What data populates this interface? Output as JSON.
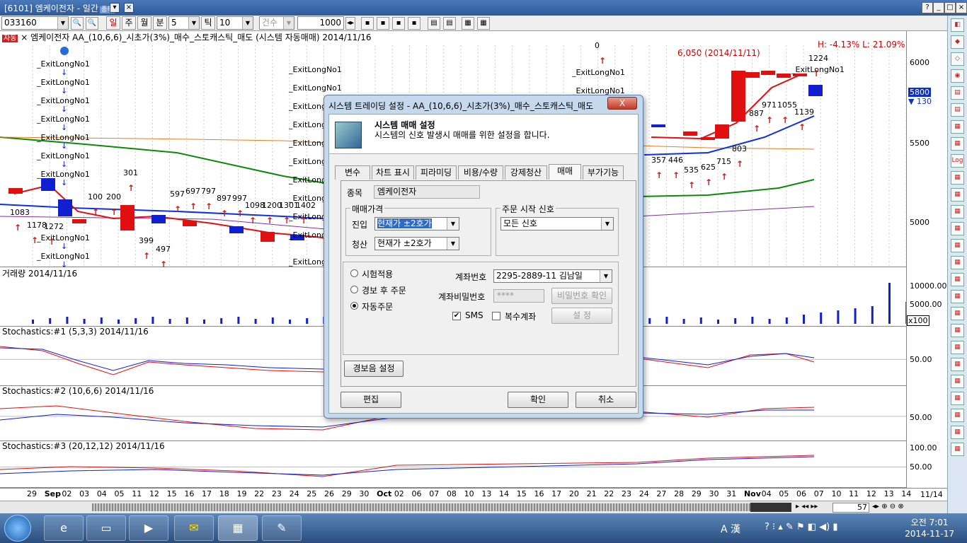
{
  "window": {
    "title": "[6101] 엠케이전자 - 일간",
    "title_badge": "종목",
    "controls": [
      "_",
      "□",
      "×"
    ]
  },
  "toolbar": {
    "code": "033160",
    "period_buttons": [
      "일",
      "주",
      "월",
      "분"
    ],
    "minute_value": "5",
    "tick_label": "틱",
    "tick_value": "10",
    "count_label": "건수",
    "count_value": "1000"
  },
  "price_panel": {
    "header": "엠케이전자 AA_(10,6,6)_시초가(3%)_매수_스토캐스틱_매도 (시스템 자동매매) 2014/11/16",
    "tag": "자동",
    "high_low": "H: -4.13%  L: 21.09%",
    "annotation_high": "6,050 (2014/11/11)",
    "axis_labels": [
      "6000",
      "5500",
      "5000"
    ],
    "current_price": "5800",
    "current_change": "▼ 130",
    "exit_label": "_ExitLongNo1",
    "signal_labels": [
      "1083",
      "1178",
      "1272",
      "100",
      "200",
      "301",
      "399",
      "497",
      "597",
      "697",
      "797",
      "897",
      "997",
      "1098",
      "1200",
      "1301",
      "1402",
      "357",
      "446",
      "535",
      "625",
      "715",
      "803",
      "887",
      "971",
      "1055",
      "1139",
      "1224",
      "0"
    ]
  },
  "volume_panel": {
    "title": "거래량 2014/11/16",
    "axis_labels": [
      "10000.00",
      "5000.00"
    ],
    "unit": "x100"
  },
  "stoch1_panel": {
    "title": "Stochastics:#1 (5,3,3) 2014/11/16",
    "axis_labels": [
      "50.00"
    ]
  },
  "stoch2_panel": {
    "title": "Stochastics:#2 (10,6,6) 2014/11/16",
    "axis_labels": [
      "50.00"
    ]
  },
  "stoch3_panel": {
    "title": "Stochastics:#3 (20,12,12) 2014/11/16",
    "axis_labels": [
      "100.00",
      "50.00"
    ]
  },
  "date_axis": [
    "29",
    "Sep",
    "02",
    "03",
    "04",
    "05",
    "11",
    "12",
    "15",
    "16",
    "17",
    "18",
    "19",
    "22",
    "23",
    "24",
    "25",
    "26",
    "29",
    "30",
    "Oct",
    "02",
    "06",
    "07",
    "08",
    "10",
    "13",
    "14",
    "15",
    "16",
    "17",
    "20",
    "21",
    "22",
    "23",
    "24",
    "27",
    "28",
    "29",
    "30",
    "31",
    "Nov",
    "04",
    "05",
    "06",
    "07",
    "10",
    "11",
    "12",
    "13",
    "14"
  ],
  "date_axis_end": "11/14",
  "scroll": {
    "count": "57"
  },
  "dialog": {
    "title": "시스템 트레이딩 설정 - AA_(10,6,6)_시초가(3%)_매수_스토캐스틱_매도",
    "close_label": "X",
    "header_title": "시스템 매매 설정",
    "header_desc": "시스템의 신호 발생시 매매를 위한 설정을 합니다.",
    "tabs": [
      "변수",
      "차트 표시",
      "피라미딩",
      "비용/수량",
      "강제청산",
      "매매",
      "부가기능"
    ],
    "active_tab": "매매",
    "stock_label": "종목",
    "stock_value": "엠케이전자",
    "price_group_title": "매매가격",
    "entry_label": "진입",
    "entry_value": "현재가 ±2호가",
    "exit_label": "청산",
    "exit_value": "현재가 ±2호가",
    "signal_group_title": "주문 시작 신호",
    "signal_value": "모든 신호",
    "modes": [
      "시험적용",
      "경보 후 주문",
      "자동주문"
    ],
    "selected_mode": "자동주문",
    "account_label": "계좌번호",
    "account_value": "2295-2889-11 김남일",
    "password_label": "계좌비밀번호",
    "password_value": "****",
    "password_check_btn": "비밀번호 확인",
    "sms_label": "SMS",
    "multi_account_label": "복수계좌",
    "settings_btn": "설 정",
    "alarm_btn": "경보음 설정",
    "edit_btn": "편집",
    "ok_btn": "확인",
    "cancel_btn": "취소"
  },
  "taskbar": {
    "ime": "A 漢",
    "time": "오전 7:01",
    "date": "2014-11-17"
  },
  "colors": {
    "up": "#e01010",
    "down": "#1020d0",
    "ma_long": "#0a8a0a",
    "ma_mid": "#1030e0",
    "ma_short": "#e08020"
  }
}
